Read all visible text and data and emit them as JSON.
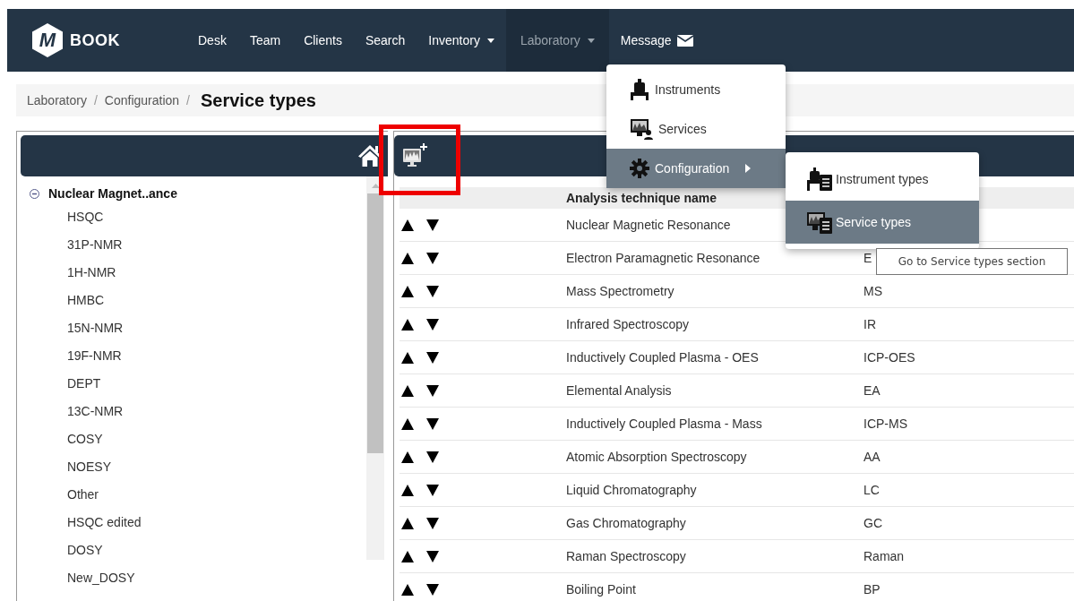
{
  "brand": {
    "logo_mark": "M",
    "name": "BOOK"
  },
  "nav": [
    {
      "label": "Desk",
      "kind": "link",
      "selected": false
    },
    {
      "label": "Team",
      "kind": "link",
      "selected": false
    },
    {
      "label": "Clients",
      "kind": "link",
      "selected": false
    },
    {
      "label": "Search",
      "kind": "link",
      "selected": false
    },
    {
      "label": "Inventory",
      "kind": "dropdown",
      "selected": false
    },
    {
      "label": "Laboratory",
      "kind": "dropdown",
      "selected": true
    },
    {
      "label": "Message",
      "kind": "mail",
      "selected": false
    }
  ],
  "breadcrumb": [
    {
      "label": "Laboratory",
      "separator": "/"
    },
    {
      "label": "Configuration",
      "separator": "/"
    }
  ],
  "page_title": "Service types",
  "tree": {
    "label": "Nuclear Magnet..ance",
    "expanded": true,
    "children": [
      {
        "label": "HSQC"
      },
      {
        "label": "31P-NMR"
      },
      {
        "label": "1H-NMR"
      },
      {
        "label": "HMBC"
      },
      {
        "label": "15N-NMR"
      },
      {
        "label": "19F-NMR"
      },
      {
        "label": "DEPT"
      },
      {
        "label": "13C-NMR"
      },
      {
        "label": "COSY"
      },
      {
        "label": "NOESY"
      },
      {
        "label": "Other"
      },
      {
        "label": "HSQC edited"
      },
      {
        "label": "DOSY"
      },
      {
        "label": "New_DOSY"
      }
    ]
  },
  "table": {
    "columns": [
      "Analysis technique name"
    ],
    "rows": [
      {
        "name": "Nuclear Magnetic Resonance"
      },
      {
        "name": "Electron Paramagnetic Resonance",
        "column_3": "E"
      },
      {
        "name": "Mass Spectrometry",
        "column_3": "MS"
      },
      {
        "name": "Infrared Spectroscopy",
        "column_3": "IR"
      },
      {
        "name": "Inductively Coupled Plasma - OES",
        "column_3": "ICP-OES"
      },
      {
        "name": "Elemental Analysis",
        "column_3": "EA"
      },
      {
        "name": "Inductively Coupled Plasma - Mass",
        "column_3": "ICP-MS"
      },
      {
        "name": "Atomic Absorption Spectroscopy",
        "column_3": "AA"
      },
      {
        "name": "Liquid Chromatography",
        "column_3": "LC"
      },
      {
        "name": "Gas Chromatography",
        "column_3": "GC"
      },
      {
        "name": "Raman Spectroscopy",
        "column_3": "Raman"
      },
      {
        "name": "Boiling Point",
        "column_3": "BP"
      }
    ]
  },
  "menu": {
    "items": [
      {
        "label": "Instruments",
        "kind": "instrument",
        "selected": false,
        "submenu": false
      },
      {
        "label": "Services",
        "kind": "service",
        "selected": false,
        "submenu": false
      },
      {
        "label": "Configuration",
        "kind": "settings",
        "selected": true,
        "submenu": true
      }
    ]
  },
  "submenu": {
    "items": [
      {
        "label": "Instrument types",
        "kind": "instrument-type",
        "selected": false
      },
      {
        "label": "Service types",
        "kind": "service-type",
        "selected": true
      }
    ]
  },
  "tooltip": "Go to Service types section"
}
